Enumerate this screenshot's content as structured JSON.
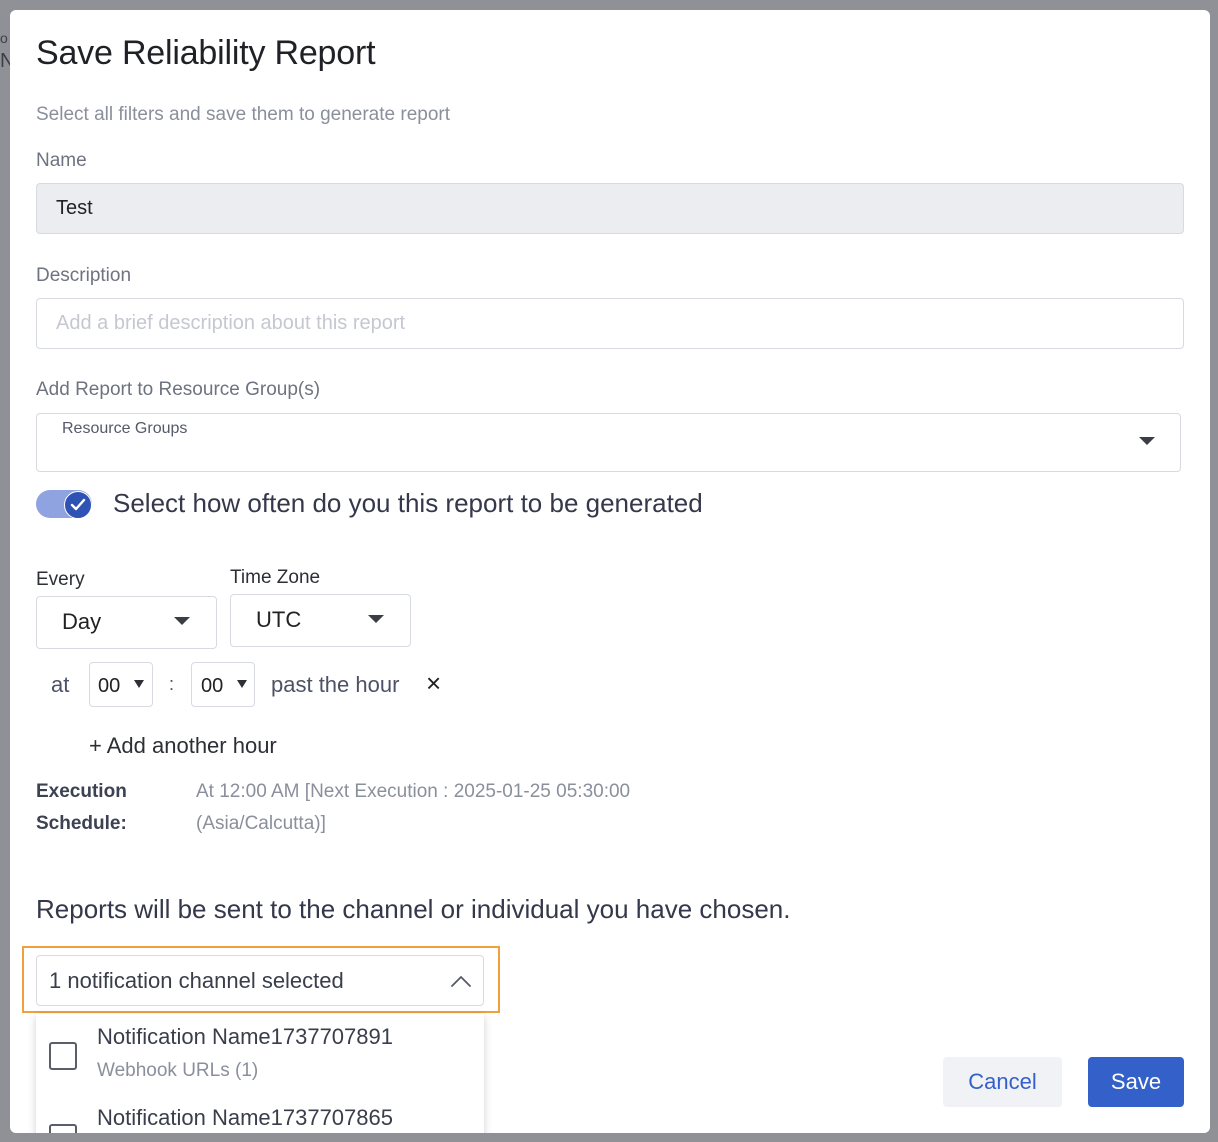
{
  "modal": {
    "title": "Save Reliability Report",
    "subtitle": "Select all filters and save them to generate report"
  },
  "name_field": {
    "label": "Name",
    "value": "Test"
  },
  "description_field": {
    "label": "Description",
    "placeholder": "Add a brief description about this report"
  },
  "resource_group": {
    "label": "Add Report to Resource Group(s)",
    "select_label": "Resource Groups"
  },
  "schedule": {
    "toggle_on": true,
    "question": "Select how often do you this report to be generated",
    "every_label": "Every",
    "every_value": "Day",
    "timezone_label": "Time Zone",
    "timezone_value": "UTC",
    "at_label": "at",
    "hour_value": "00",
    "colon": ":",
    "minute_value": "00",
    "past_the_hour": "past the hour",
    "remove_symbol": "×",
    "add_hour": "+ Add another hour",
    "execution_label_1": "Execution",
    "execution_label_2": "Schedule:",
    "execution_value_1": "At 12:00 AM [Next Execution : 2025-01-25 05:30:00",
    "execution_value_2": "(Asia/Calcutta)]"
  },
  "notifications": {
    "heading": "Reports will be sent to the channel or individual you have chosen.",
    "selector_label": "1 notification channel selected",
    "options": [
      {
        "name": "Notification Name1737707891",
        "sub": "Webhook URLs (1)"
      },
      {
        "name": "Notification Name1737707865",
        "sub": ""
      }
    ]
  },
  "actions": {
    "cancel": "Cancel",
    "save": "Save"
  },
  "colors": {
    "primary": "#3461c9",
    "highlight": "#f0a03c",
    "toggle_track": "#8ea3e0"
  }
}
